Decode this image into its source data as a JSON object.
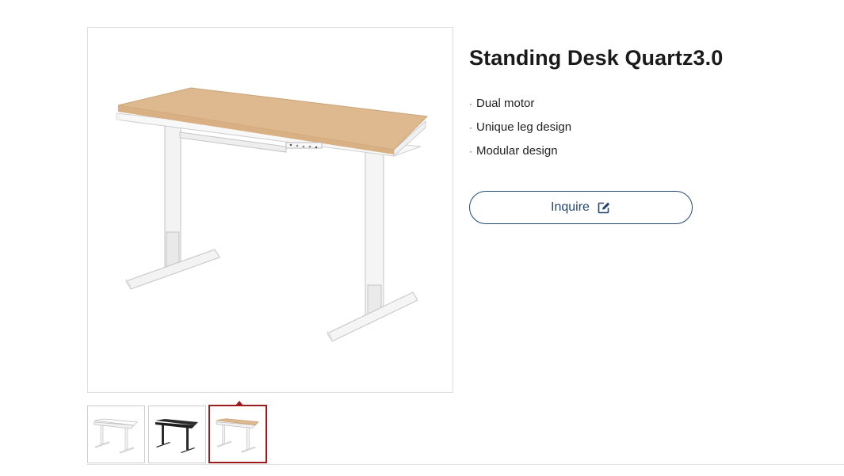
{
  "product": {
    "title": "Standing Desk Quartz3.0",
    "main_image": "standing-desk-wood-top",
    "features": [
      {
        "bullet": "·",
        "text": "Dual motor"
      },
      {
        "bullet": "·",
        "text": "Unique leg design"
      },
      {
        "bullet": "·",
        "text": "Modular design"
      }
    ],
    "inquire_label": "Inquire",
    "inquire_icon": "edit-icon"
  },
  "gallery": {
    "thumbnails": [
      {
        "variant": "white-top-white-frame",
        "selected": false
      },
      {
        "variant": "black-top-black-frame",
        "selected": false
      },
      {
        "variant": "wood-top-white-frame",
        "selected": true
      }
    ]
  },
  "colors": {
    "accent": "#25466e",
    "selected_border": "#9b1c1c",
    "wood": "#deb88e",
    "frame_white": "#f3f3f3",
    "frame_black": "#2b2b2b"
  }
}
